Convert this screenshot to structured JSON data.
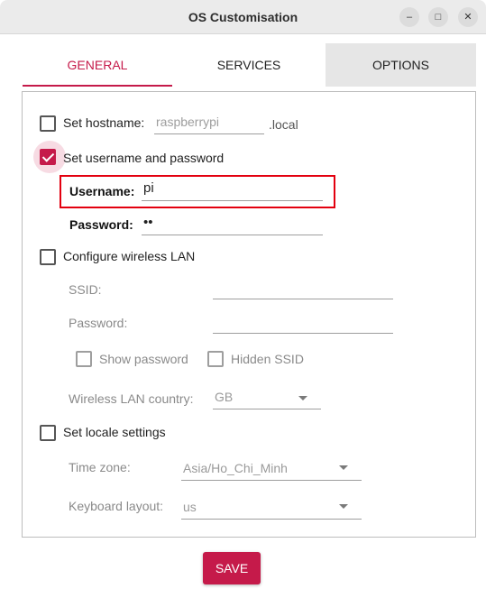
{
  "window": {
    "title": "OS Customisation",
    "controls": {
      "minimize": "–",
      "maximize": "□",
      "close": "✕"
    }
  },
  "tabs": [
    {
      "label": "GENERAL",
      "active": true
    },
    {
      "label": "SERVICES",
      "active": false
    },
    {
      "label": "OPTIONS",
      "active": false
    }
  ],
  "general": {
    "hostname": {
      "checked": false,
      "label": "Set hostname:",
      "placeholder": "raspberrypi",
      "suffix": ".local"
    },
    "user": {
      "checked": true,
      "label": "Set username and password",
      "username_label": "Username:",
      "username_value": "pi",
      "password_label": "Password:",
      "password_value": "••"
    },
    "wireless": {
      "checked": false,
      "label": "Configure wireless LAN",
      "ssid_label": "SSID:",
      "password_label": "Password:",
      "show_password_label": "Show password",
      "hidden_ssid_label": "Hidden SSID",
      "country_label": "Wireless LAN country:",
      "country_value": "GB"
    },
    "locale": {
      "checked": false,
      "label": "Set locale settings",
      "timezone_label": "Time zone:",
      "timezone_value": "Asia/Ho_Chi_Minh",
      "keyboard_label": "Keyboard layout:",
      "keyboard_value": "us"
    }
  },
  "actions": {
    "save_label": "SAVE"
  },
  "colors": {
    "accent": "#c51a4a",
    "highlight_box": "#e3000f"
  }
}
